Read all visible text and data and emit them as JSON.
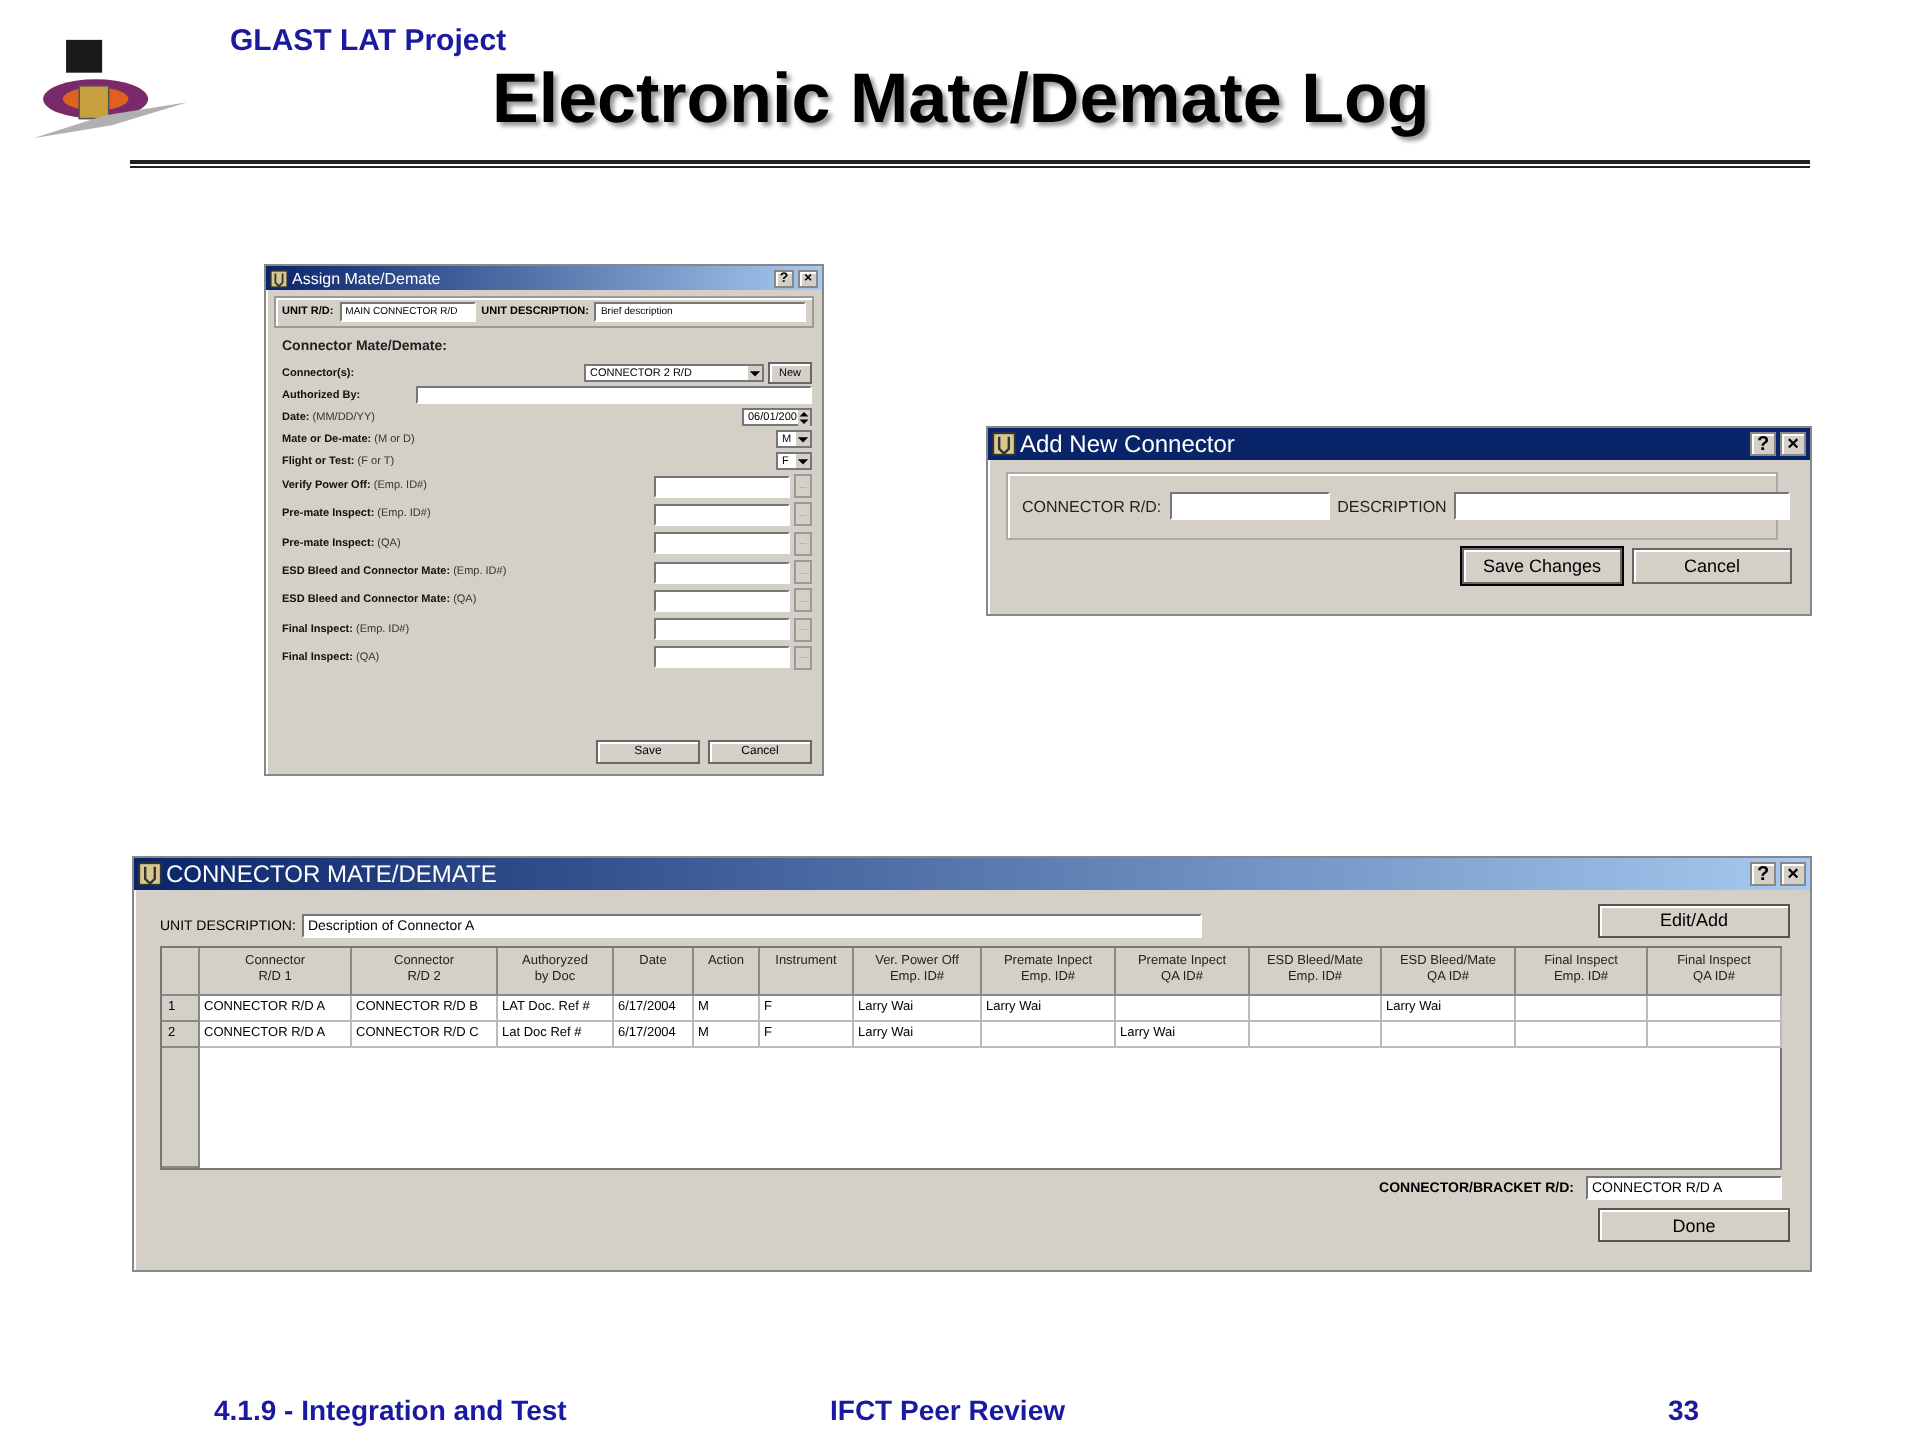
{
  "header": {
    "project": "GLAST LAT Project",
    "title": "Electronic Mate/Demate Log"
  },
  "assign_dialog": {
    "title": "Assign Mate/Demate",
    "help": "?",
    "close": "×",
    "unit_rd_label": "UNIT R/D:",
    "unit_rd_value": "MAIN CONNECTOR R/D",
    "unit_desc_label": "UNIT DESCRIPTION:",
    "unit_desc_value": "Brief description",
    "section_title": "Connector Mate/Demate:",
    "rows": [
      {
        "kind": "combo",
        "label": "**Connector(s):**",
        "value": "CONNECTOR 2 R/D",
        "button": "New"
      },
      {
        "kind": "text",
        "label": "**Authorized By:**"
      },
      {
        "kind": "spin",
        "label": "**Date:** (MM/DD/YY)",
        "value": "06/01/200"
      },
      {
        "kind": "select",
        "label": "**Mate or De-mate:** (M or D)",
        "value": "M"
      },
      {
        "kind": "select",
        "label": "**Flight or Test:** (F or T)",
        "value": "F"
      },
      {
        "kind": "lookup",
        "label": "**Verify Power Off:** (Emp. ID#)",
        "button": "..."
      },
      {
        "kind": "lookup",
        "label": "**Pre-mate Inspect:** (Emp. ID#)",
        "button": "..."
      },
      {
        "kind": "lookup",
        "label": "**Pre-mate Inspect:** (QA)",
        "button": "..."
      },
      {
        "kind": "lookup",
        "label": "**ESD Bleed and Connector Mate:** (Emp. ID#)",
        "button": "..."
      },
      {
        "kind": "lookup",
        "label": "**ESD Bleed and Connector Mate:** (QA)",
        "button": "..."
      },
      {
        "kind": "lookup",
        "label": "**Final Inspect:** (Emp. ID#)",
        "button": "..."
      },
      {
        "kind": "lookup",
        "label": "**Final Inspect:** (QA)",
        "button": "..."
      }
    ],
    "buttons": [
      "Save",
      "Cancel"
    ]
  },
  "add_dialog": {
    "title": "Add New Connector",
    "help": "?",
    "close": "×",
    "connector_label": "CONNECTOR R/D:",
    "description_label": "DESCRIPTION",
    "buttons": [
      "Save Changes",
      "Cancel"
    ]
  },
  "log_window": {
    "title": "CONNECTOR MATE/DEMATE",
    "help": "?",
    "close": "×",
    "unit_desc_label": "UNIT DESCRIPTION:",
    "unit_desc_value": "Description of Connector A",
    "edit_button": "Edit/Add",
    "table": {
      "columns": [
        "Connector\nR/D 1",
        "Connector\nR/D 2",
        "Authoryzed\nby Doc",
        "Date",
        "Action",
        "Instrument",
        "Ver. Power Off\nEmp. ID#",
        "Premate Inpect\nEmp. ID#",
        "Premate Inpect\nQA ID#",
        "ESD Bleed/Mate\nEmp. ID#",
        "ESD Bleed/Mate\nQA ID#",
        "Final Inspect\nEmp. ID#",
        "Final Inspect\nQA ID#"
      ],
      "rows": [
        {
          "number": "1",
          "cells": [
            "CONNECTOR R/D A",
            "CONNECTOR R/D B",
            "LAT Doc. Ref #",
            "6/17/2004",
            "M",
            "F",
            "Larry Wai",
            "Larry Wai",
            "",
            "",
            "Larry Wai",
            "",
            ""
          ]
        },
        {
          "number": "2",
          "cells": [
            "CONNECTOR R/D A",
            "CONNECTOR R/D C",
            "Lat Doc Ref #",
            "6/17/2004",
            "M",
            "F",
            "Larry Wai",
            "",
            "Larry Wai",
            "",
            "",
            "",
            ""
          ]
        }
      ]
    },
    "bracket_label": "CONNECTOR/BRACKET R/D:",
    "bracket_value": "CONNECTOR R/D A",
    "done_button": "Done"
  },
  "footer": {
    "section": "4.1.9 - Integration and Test",
    "event": "IFCT Peer Review",
    "page": "33"
  }
}
